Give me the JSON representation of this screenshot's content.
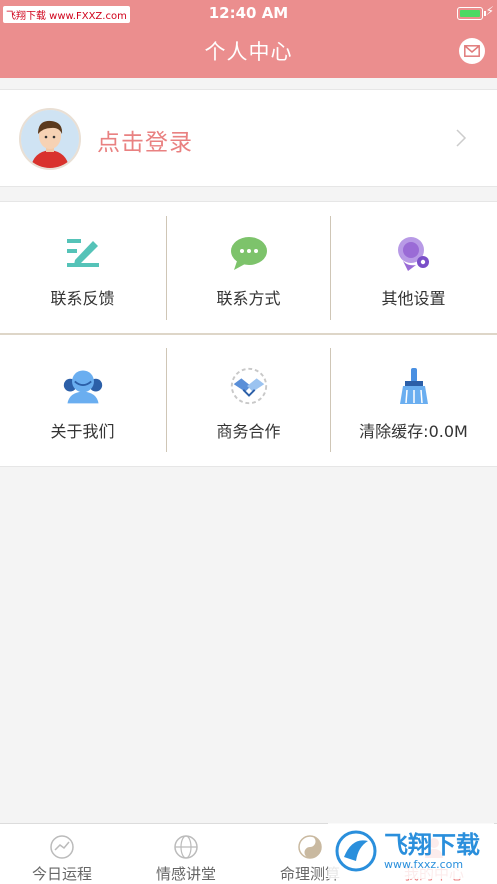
{
  "status": {
    "time": "12:40 AM",
    "watermark": "飞翔下载 www.FXXZ.com"
  },
  "header": {
    "title": "个人中心",
    "mail_icon": "mail-icon"
  },
  "login": {
    "prompt": "点击登录"
  },
  "grid": {
    "items": [
      {
        "label": "联系反馈",
        "icon": "feedback-pencil-icon",
        "color": "#55c3b8"
      },
      {
        "label": "联系方式",
        "icon": "chat-bubble-icon",
        "color": "#7dc36b"
      },
      {
        "label": "其他设置",
        "icon": "settings-icon",
        "color": "#9a6bd6"
      },
      {
        "label": "关于我们",
        "icon": "users-icon",
        "color": "#6aaef0"
      },
      {
        "label": "商务合作",
        "icon": "handshake-icon",
        "color": "#5a8fd8"
      },
      {
        "label": "清除缓存:0.0M",
        "icon": "broom-icon",
        "color": "#4a90e2"
      }
    ]
  },
  "tabbar": {
    "tabs": [
      {
        "label": "今日运程",
        "icon": "chart-icon",
        "active": false
      },
      {
        "label": "情感讲堂",
        "icon": "globe-icon",
        "active": false
      },
      {
        "label": "命理测算",
        "icon": "yin-yang-icon",
        "active": false
      },
      {
        "label": "我的中心",
        "icon": "profile-icon",
        "active": true
      }
    ]
  },
  "brand_watermark": {
    "name": "飞翔下载",
    "url": "www.fxxz.com"
  },
  "colors": {
    "accent": "#eb8e8e",
    "accent_text": "#e98181"
  }
}
